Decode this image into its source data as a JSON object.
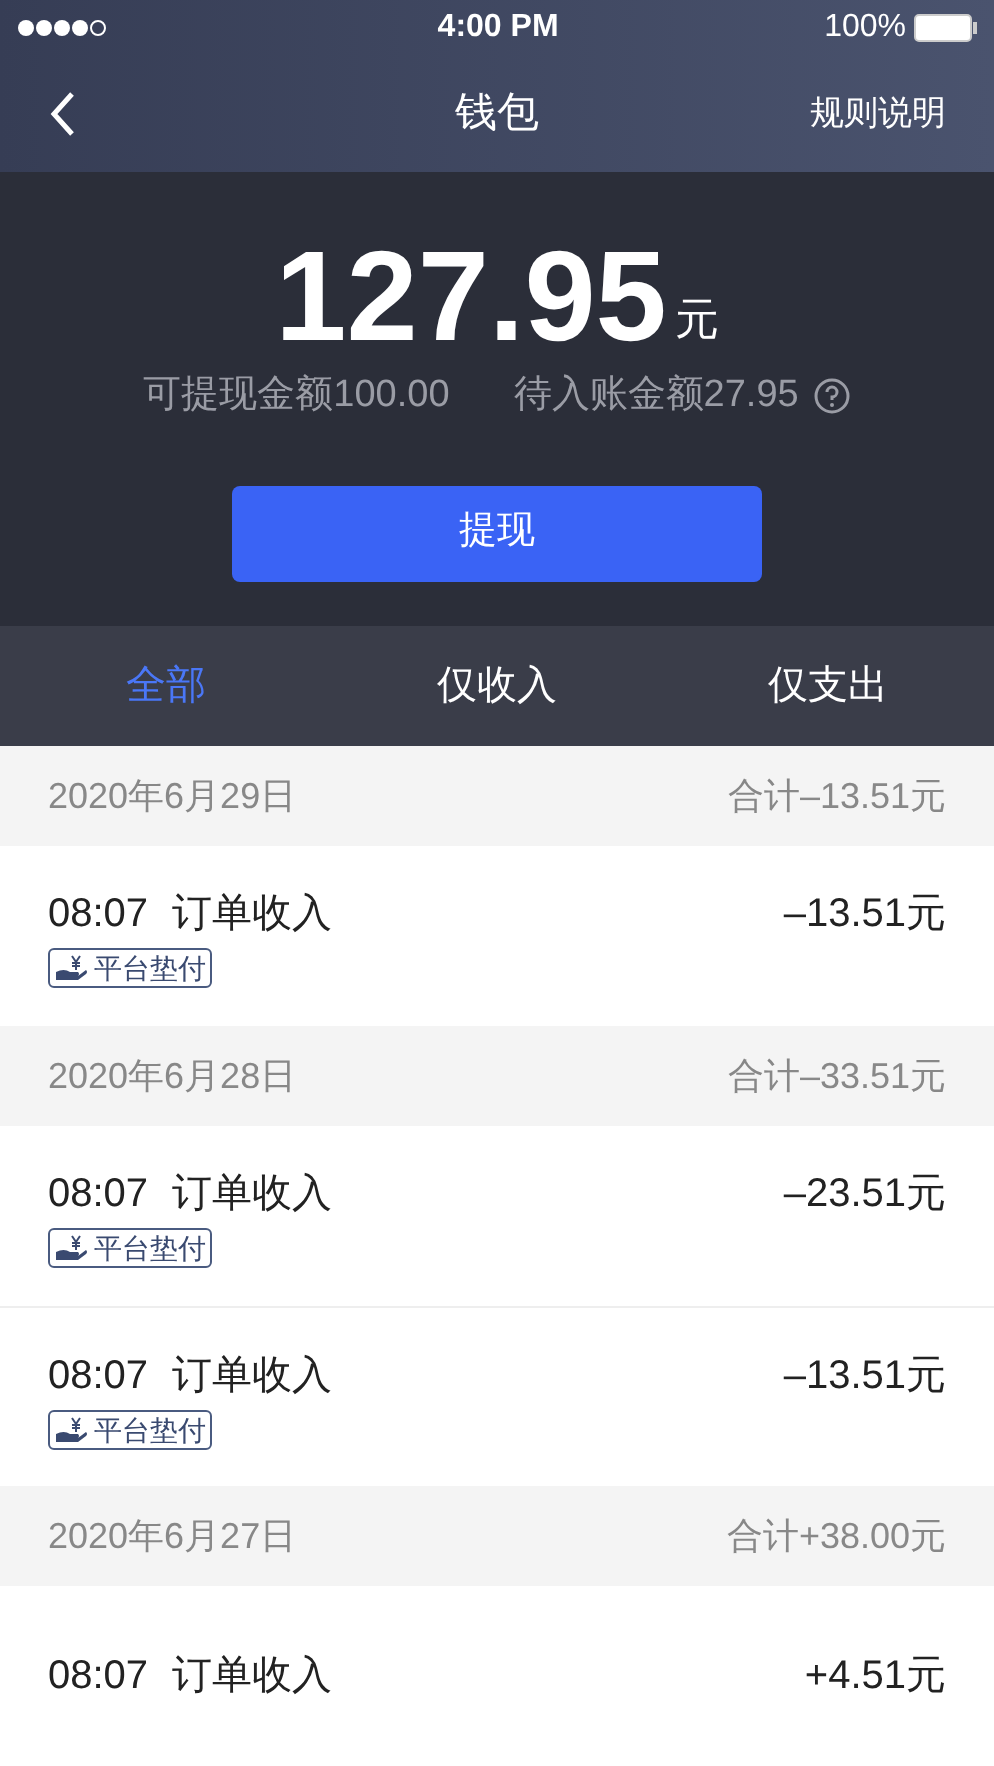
{
  "status_bar": {
    "time": "4:00 PM",
    "battery": "100%"
  },
  "nav": {
    "title": "钱包",
    "action": "规则说明"
  },
  "balance": {
    "amount": "127.95",
    "unit": "元",
    "withdrawable": "可提现金额100.00",
    "pending": "待入账金额27.95",
    "button": "提现"
  },
  "tabs": [
    {
      "label": "全部",
      "selected": true
    },
    {
      "label": "仅收入",
      "selected": false
    },
    {
      "label": "仅支出",
      "selected": false
    }
  ],
  "groups": [
    {
      "date": "2020年6月29日",
      "total": "合计–13.51元",
      "items": [
        {
          "time": "08:07",
          "title": "订单收入",
          "amount": "–13.51元",
          "tag": "平台垫付"
        }
      ]
    },
    {
      "date": "2020年6月28日",
      "total": "合计–33.51元",
      "items": [
        {
          "time": "08:07",
          "title": "订单收入",
          "amount": "–23.51元",
          "tag": "平台垫付"
        },
        {
          "time": "08:07",
          "title": "订单收入",
          "amount": "–13.51元",
          "tag": "平台垫付"
        }
      ]
    },
    {
      "date": "2020年6月27日",
      "total": "合计+38.00元",
      "items": [
        {
          "time": "08:07",
          "title": "订单收入",
          "amount": "+4.51元"
        }
      ]
    }
  ]
}
